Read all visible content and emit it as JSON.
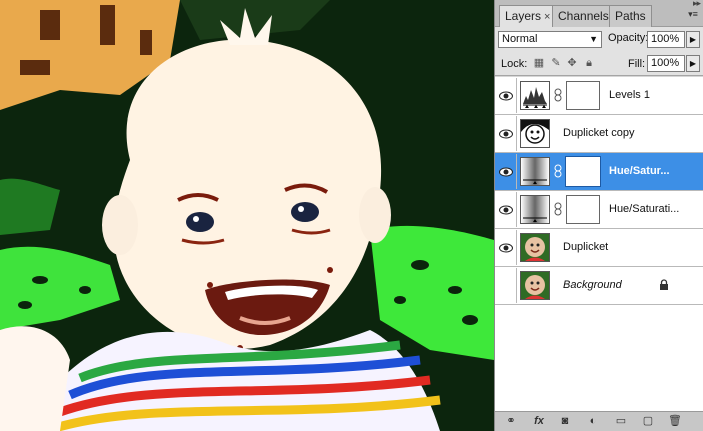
{
  "panel": {
    "tabs": [
      {
        "label": "Layers",
        "close": "×"
      },
      {
        "label": "Channels"
      },
      {
        "label": "Paths"
      }
    ],
    "blend_mode": "Normal",
    "opacity_label": "Opacity:",
    "opacity": "100%",
    "lock_label": "Lock:",
    "fill_label": "Fill:",
    "fill": "100%"
  },
  "layers": [
    {
      "name": "Levels 1",
      "visible": true,
      "type": "adjustment-levels",
      "selected": false
    },
    {
      "name": "Duplicket copy",
      "visible": true,
      "type": "pixel-sketch",
      "selected": false
    },
    {
      "name": "Hue/Satur...",
      "visible": true,
      "type": "adjustment-hue",
      "selected": true
    },
    {
      "name": "Hue/Saturati...",
      "visible": true,
      "type": "adjustment-hue",
      "selected": false
    },
    {
      "name": "Duplicket",
      "visible": true,
      "type": "pixel-photo",
      "selected": false
    },
    {
      "name": "Background",
      "visible": false,
      "type": "pixel-photo",
      "selected": false,
      "locked": true
    }
  ],
  "bottom_icons": [
    "link-icon",
    "fx-icon",
    "mask-icon",
    "adjustment-icon",
    "folder-icon",
    "new-layer-icon",
    "trash-icon"
  ],
  "colors": {
    "selection": "#3d8fe6",
    "grass": "#3ee83a",
    "skin": "#fff3e3"
  }
}
